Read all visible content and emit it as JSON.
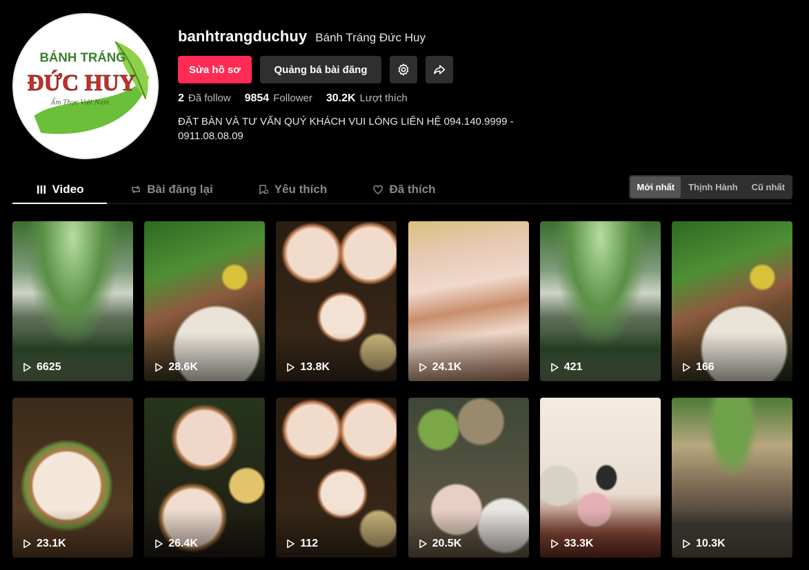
{
  "profile": {
    "avatar_text_top": "BÁNH TRÁNG",
    "avatar_text_main": "ĐỨC HUY",
    "avatar_text_tagline": "Ẩm Thực Việt Nam",
    "username": "banhtrangduchuy",
    "nickname": "Bánh Tráng Đức Huy",
    "edit_label": "Sửa hồ sơ",
    "promote_label": "Quảng bá bài đăng",
    "bio_line1": "ĐẶT BÀN VÀ TƯ VẤN QUÝ KHÁCH VUI LÒNG LIÊN HỆ 094.140.9999 -",
    "bio_line2": "0911.08.08.09"
  },
  "stats": [
    {
      "value": "2",
      "label": "Đã follow"
    },
    {
      "value": "9854",
      "label": "Follower"
    },
    {
      "value": "30.2K",
      "label": "Lượt thích"
    }
  ],
  "tabs": [
    {
      "label": "Video",
      "icon": "grid-icon",
      "active": true
    },
    {
      "label": "Bài đăng lại",
      "icon": "repost-icon",
      "active": false
    },
    {
      "label": "Yêu thích",
      "icon": "bookmark-icon",
      "active": false
    },
    {
      "label": "Đã thích",
      "icon": "heart-icon",
      "active": false
    }
  ],
  "sort": [
    {
      "label": "Mới nhất",
      "active": true
    },
    {
      "label": "Thịnh Hành",
      "active": false
    },
    {
      "label": "Cũ nhất",
      "active": false
    }
  ],
  "videos": [
    {
      "views": "6625",
      "scene": "restaurant"
    },
    {
      "views": "28.6K",
      "scene": "herbs"
    },
    {
      "views": "13.8K",
      "scene": "pork"
    },
    {
      "views": "24.1K",
      "scene": "closeup"
    },
    {
      "views": "421",
      "scene": "restaurant"
    },
    {
      "views": "166",
      "scene": "herbs"
    },
    {
      "views": "23.1K",
      "scene": "plate"
    },
    {
      "views": "26.4K",
      "scene": "hold"
    },
    {
      "views": "112",
      "scene": "pork"
    },
    {
      "views": "20.5K",
      "scene": "spread"
    },
    {
      "views": "33.3K",
      "scene": "girl"
    },
    {
      "views": "10.3K",
      "scene": "dining"
    }
  ],
  "colors": {
    "accent": "#fe2c55",
    "button_dark": "#2f2f2f",
    "background": "#000000",
    "logo_green": "#2e9a3a",
    "logo_text": "#3b7d2a"
  }
}
